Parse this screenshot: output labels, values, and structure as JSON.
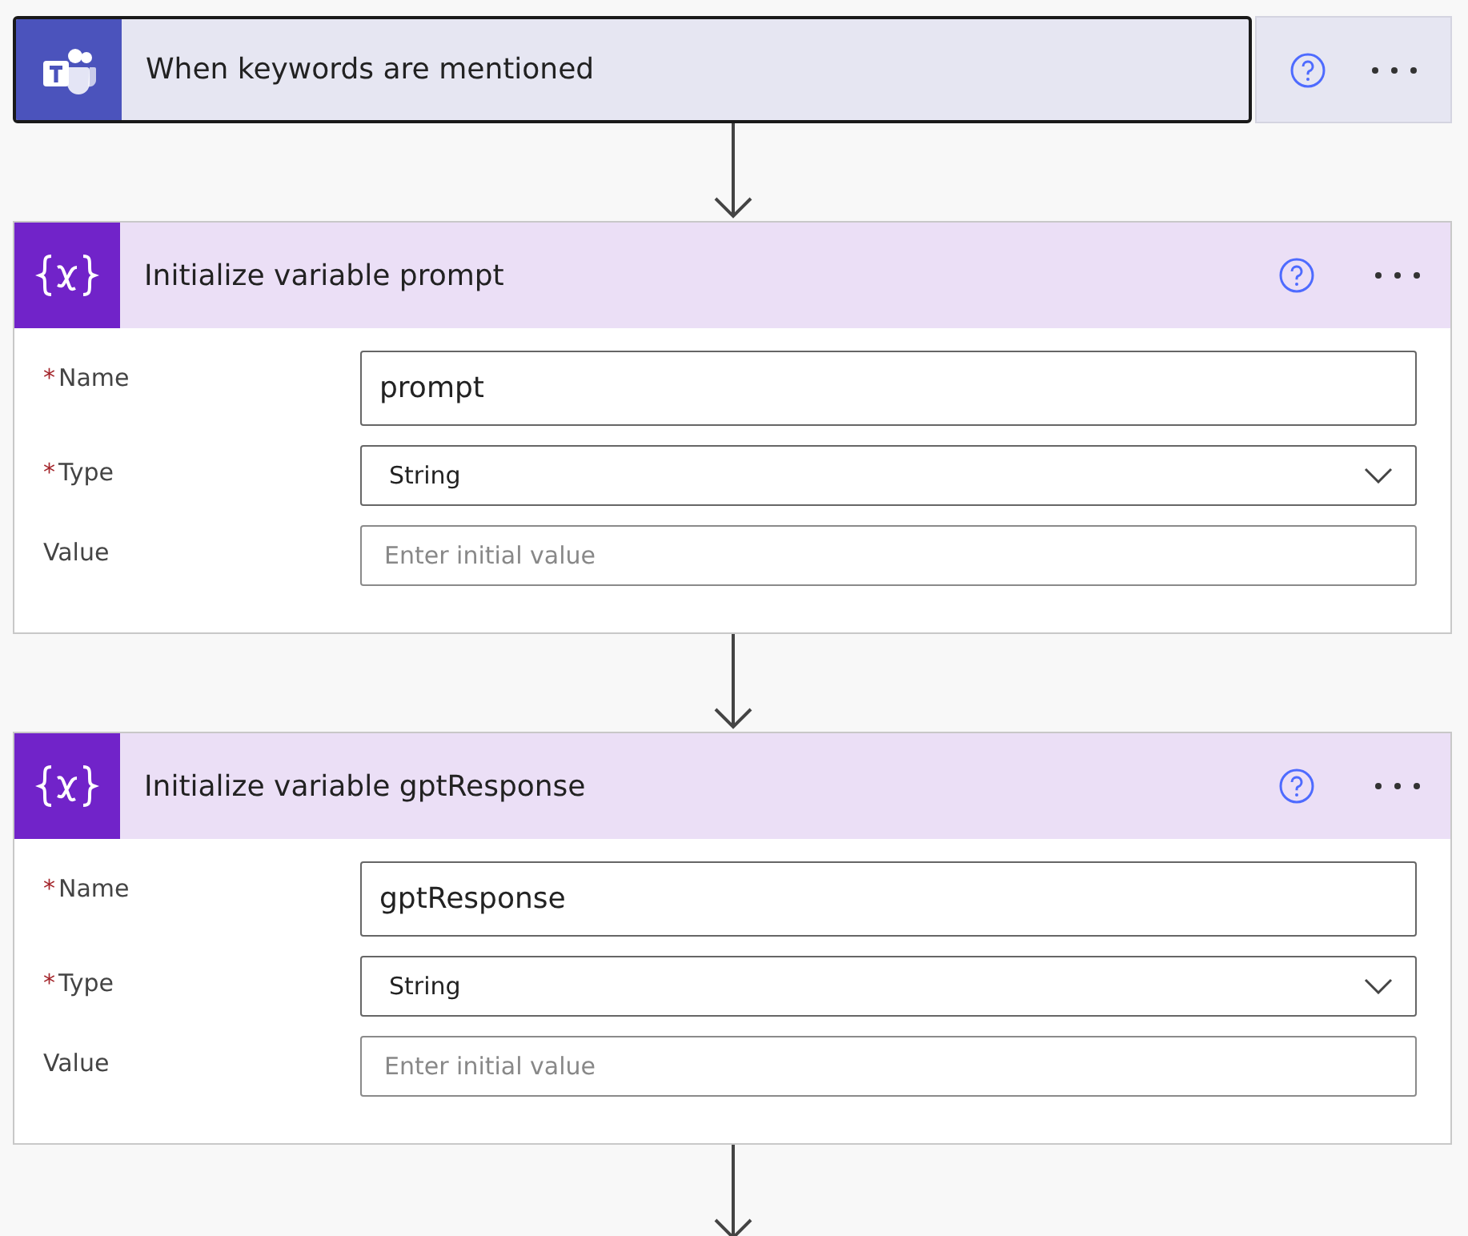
{
  "steps": [
    {
      "kind": "trigger",
      "title": "When keywords are mentioned",
      "selected": true
    },
    {
      "kind": "variable",
      "title": "Initialize variable prompt",
      "selected": false,
      "fields": [
        {
          "label": "Name",
          "required_mark": "*",
          "kind": "text",
          "value": "prompt"
        },
        {
          "label": "Type",
          "required_mark": "*",
          "kind": "dropdown",
          "value": "String"
        },
        {
          "label": "Value",
          "kind": "text",
          "placeholder": "Enter initial value"
        }
      ]
    },
    {
      "kind": "variable",
      "title": "Initialize variable gptResponse",
      "selected": false,
      "fields": [
        {
          "label": "Name",
          "required_mark": "*",
          "kind": "text",
          "value": "gptResponse"
        },
        {
          "label": "Type",
          "required_mark": "*",
          "kind": "dropdown",
          "value": "String"
        },
        {
          "label": "Value",
          "kind": "text",
          "placeholder": "Enter initial value"
        }
      ]
    }
  ]
}
